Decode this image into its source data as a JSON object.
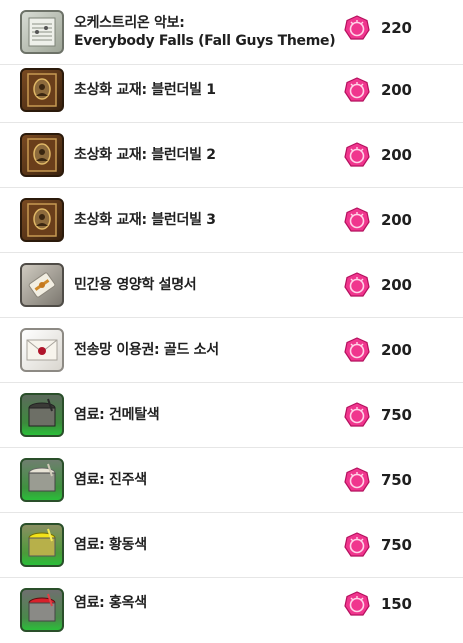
{
  "items": [
    {
      "name_line1": "오케스트리온 악보:",
      "name_line2": "Everybody Falls (Fall Guys Theme)",
      "price": "220",
      "icon": "music-sheet-icon"
    },
    {
      "name_line1": "초상화 교재: 블런더빌 1",
      "name_line2": "",
      "price": "200",
      "icon": "portrait-book-icon"
    },
    {
      "name_line1": "초상화 교재: 블런더빌 2",
      "name_line2": "",
      "price": "200",
      "icon": "portrait-book-icon"
    },
    {
      "name_line1": "초상화 교재: 블런더빌 3",
      "name_line2": "",
      "price": "200",
      "icon": "portrait-book-icon"
    },
    {
      "name_line1": "민간용 영양학 설명서",
      "name_line2": "",
      "price": "200",
      "icon": "scroll-icon"
    },
    {
      "name_line1": "전송망 이용권: 골드 소서",
      "name_line2": "",
      "price": "200",
      "icon": "sealed-letter-icon"
    },
    {
      "name_line1": "염료: 건메탈색",
      "name_line2": "",
      "price": "750",
      "icon": "dye-pot-icon",
      "dye_color": "#3a3a36"
    },
    {
      "name_line1": "염료: 진주색",
      "name_line2": "",
      "price": "750",
      "icon": "dye-pot-icon",
      "dye_color": "#e8e4d6"
    },
    {
      "name_line1": "염료: 황동색",
      "name_line2": "",
      "price": "750",
      "icon": "dye-pot-icon",
      "dye_color": "#f2e21a"
    },
    {
      "name_line1": "염료: 홍옥색",
      "name_line2": "",
      "price": "150",
      "icon": "dye-pot-icon",
      "dye_color": "#d8202a"
    }
  ],
  "currency_icon": "currency-coin-icon",
  "colors": {
    "coin_fill": "#f0368e",
    "coin_border": "#b5105e",
    "coin_inner": "#ffd3e8"
  }
}
